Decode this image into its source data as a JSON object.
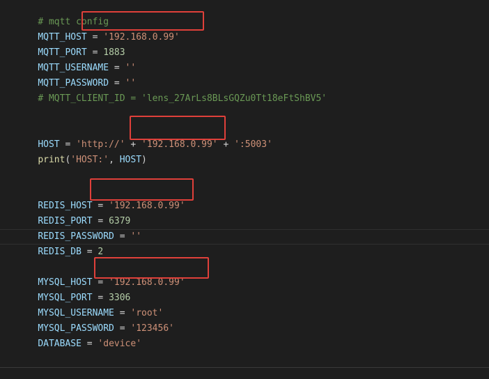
{
  "code": {
    "comment_mqtt": "# mqtt config",
    "mqtt_host": {
      "name": "MQTT_HOST",
      "eq": " = ",
      "value": "'192.168.0.99'"
    },
    "mqtt_port": {
      "name": "MQTT_PORT",
      "eq": " = ",
      "value": "1883"
    },
    "mqtt_username": {
      "name": "MQTT_USERNAME",
      "eq": " = ",
      "value": "''"
    },
    "mqtt_password": {
      "name": "MQTT_PASSWORD",
      "eq": " = ",
      "value": "''"
    },
    "comment_client_id": "# MQTT_CLIENT_ID = 'lens_27ArLs8BLsGQZu0Tt18eFtShBV5'",
    "host": {
      "name": "HOST",
      "eq": " = ",
      "part1": "'http://'",
      "plus1": " + ",
      "part2": "'192.168.0.99'",
      "plus2": " + ",
      "part3": "':5003'"
    },
    "print": {
      "fn": "print",
      "open": "(",
      "arg1": "'HOST:'",
      "comma": ", ",
      "arg2": "HOST",
      "close": ")"
    },
    "redis_host": {
      "name": "REDIS_HOST",
      "eq": " = ",
      "value": "'192.168.0.99'"
    },
    "redis_port": {
      "name": "REDIS_PORT",
      "eq": " = ",
      "value": "6379"
    },
    "redis_password": {
      "name": "REDIS_PASSWORD",
      "eq": " = ",
      "value": "''"
    },
    "redis_db": {
      "name": "REDIS_DB",
      "eq": " = ",
      "value": "2"
    },
    "mysql_host": {
      "name": "MYSQL_HOST",
      "eq": " = ",
      "value": "'192.168.0.99'"
    },
    "mysql_port": {
      "name": "MYSQL_PORT",
      "eq": " = ",
      "value": "3306"
    },
    "mysql_username": {
      "name": "MYSQL_USERNAME",
      "eq": " = ",
      "value": "'root'"
    },
    "mysql_password": {
      "name": "MYSQL_PASSWORD",
      "eq": " = ",
      "value": "'123456'"
    },
    "database": {
      "name": "DATABASE",
      "eq": " = ",
      "value": "'device'"
    }
  },
  "colors": {
    "background": "#1e1e1e",
    "highlight_box": "#e0403a",
    "comment": "#6a9955",
    "variable": "#9cdcfe",
    "string": "#ce9178",
    "number": "#b5cea8",
    "function": "#dcdcaa"
  }
}
